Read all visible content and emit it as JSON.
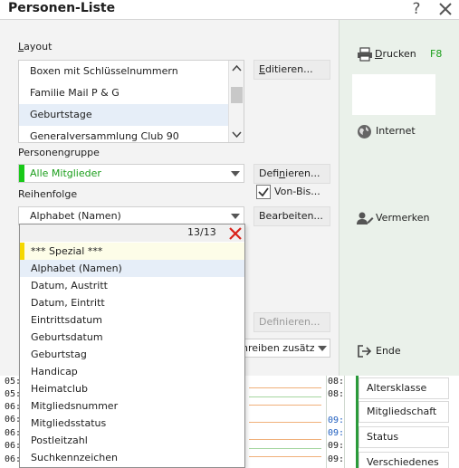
{
  "window": {
    "title": "Personen-Liste",
    "help_label": "?"
  },
  "layout": {
    "label_prefix": "L",
    "label_rest": "ayout",
    "items": [
      {
        "label": "Boxen  mit Schlüsselnummern"
      },
      {
        "label": "Familie Mail P & G"
      },
      {
        "label": "Geburtstage",
        "selected": true
      },
      {
        "label": "Generalversammlung Club 90"
      }
    ],
    "edit_button_prefix": "E",
    "edit_button_rest": "ditieren..."
  },
  "personengruppe": {
    "label": "Personengruppe",
    "value": "Alle Mitglieder",
    "define_prefix": "Defi",
    "define_underlined": "n",
    "define_rest": "ieren...",
    "checkbox_label": "Von-Bis...",
    "checkbox_checked": true,
    "value_color": "#1a9e1a"
  },
  "reihenfolge": {
    "label": "Reihenfolge",
    "value": "Alphabet (Namen)",
    "edit_label": "Bearbeiten..."
  },
  "hidden_row": {
    "define_label": "Definieren...",
    "schreiben_label": "hreiben zusätzl"
  },
  "sidebar": {
    "drucken_prefix": "D",
    "drucken_rest": "rucken",
    "drucken_shortcut": "F8",
    "internet_label": "Internet",
    "vermerken_label": "Vermerken",
    "ende_label": "Ende"
  },
  "background_list": {
    "items": [
      "Altersklasse",
      "Mitgliedschaft",
      "Status",
      "Verschiedenes"
    ]
  },
  "background_times": {
    "left": [
      "05:",
      "05:",
      "06:",
      "06:",
      "06:",
      "06:",
      "06:"
    ],
    "right": [
      "08:",
      "08:",
      "09:",
      "09:",
      "09:",
      "09:",
      "09:"
    ]
  },
  "dropdown": {
    "count": "13/13",
    "items": [
      {
        "label": "*** Spezial ***",
        "special": true
      },
      {
        "label": "Alphabet (Namen)",
        "selected": true
      },
      {
        "label": "Datum, Austritt"
      },
      {
        "label": "Datum, Eintritt"
      },
      {
        "label": "Eintrittsdatum"
      },
      {
        "label": "Geburtsdatum"
      },
      {
        "label": "Geburtstag"
      },
      {
        "label": "Handicap"
      },
      {
        "label": "Heimatclub"
      },
      {
        "label": "Mitgliedsnummer"
      },
      {
        "label": "Mitgliedsstatus"
      },
      {
        "label": "Postleitzahl"
      },
      {
        "label": "Suchkennzeichen"
      }
    ]
  },
  "colors": {
    "accent_green": "#19c919",
    "special_yellow": "#f5d800",
    "clear_red": "#d9221a",
    "shortcut_green": "#1a9e1a"
  }
}
